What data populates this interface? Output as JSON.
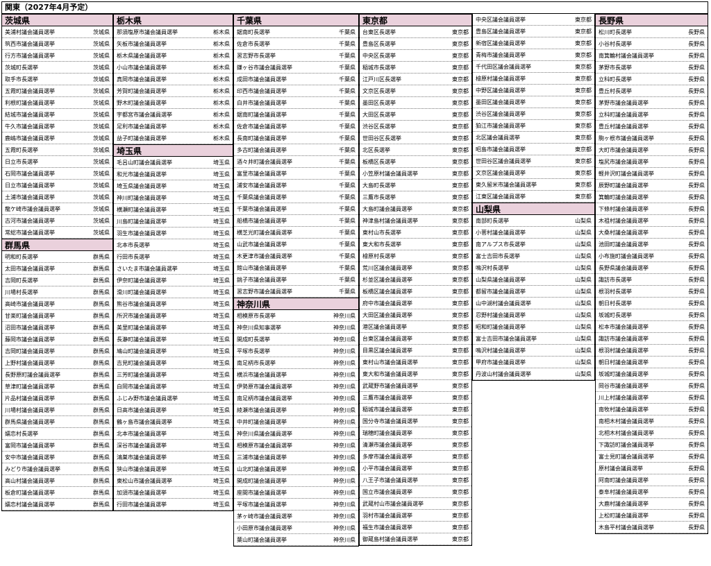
{
  "title": "関東（2027年4月予定）",
  "columns": [
    {
      "groups": [
        {
          "pref": "茨城県",
          "suffix": "茨城県",
          "items": [
            "美浦村議会議員選挙",
            "筑西市議会議員選挙",
            "行方市議会議員選挙",
            "茨城町長選挙",
            "取手市長選挙",
            "五霞町議会議員選挙",
            "利根町議会議員選挙",
            "結城市議会議員選挙",
            "牛久市議会議員選挙",
            "鹿嶋市議会議員選挙",
            "五霞町長選挙",
            "日立市長選挙",
            "石岡市議会議員選挙",
            "日立市議会議員選挙",
            "土浦市議会議員選挙",
            "龍ケ崎市議会議員選挙",
            "古河市議会議員選挙",
            "常総市議会議員選挙"
          ]
        },
        {
          "pref": "群馬県",
          "suffix": "群馬県",
          "items": [
            "明和町長選挙",
            "太田市議会議員選挙",
            "吉岡町長選挙",
            "川場村長選挙",
            "高崎市議会議員選挙",
            "甘楽町議会議員選挙",
            "沼田市議会議員選挙",
            "藤岡市議会議員選挙",
            "吉岡町議会議員選挙",
            "上野村議会議員選挙",
            "長野原町議会議員選挙",
            "草津町議会議員選挙",
            "片品村議会議員選挙",
            "川場村議会議員選挙",
            "群馬県議会議員選挙",
            "嬬恋村長選挙",
            "富岡市議会議員選挙",
            "安中市議会議員選挙",
            "みどり市議会議員選挙",
            "高山村議会議員選挙",
            "板倉町議会議員選挙",
            "嬬恋村議会議員選挙"
          ]
        }
      ]
    },
    {
      "groups": [
        {
          "pref": "栃木県",
          "suffix": "栃木県",
          "items": [
            "那須塩原市議会議員選挙",
            "矢板市議会議員選挙",
            "栃木県議会議員選挙",
            "小山市議会議員選挙",
            "真岡市議会議員選挙",
            "芳賀町議会議員選挙",
            "野木町議会議員選挙",
            "宇都宮市議会議員選挙",
            "足利市議会議員選挙",
            "益子町議会議員選挙"
          ]
        },
        {
          "pref": "埼玉県",
          "suffix": "埼玉県",
          "items": [
            "毛呂山町議会議員選挙",
            "和光市議会議員選挙",
            "埼玉県議会議員選挙",
            "神川町議会議員選挙",
            "横瀬町議会議員選挙",
            "川島町議会議員選挙",
            "羽生市議会議員選挙",
            "北本市長選挙",
            "行田市長選挙",
            "さいたま市議会議員選挙",
            "伊奈町議会議員選挙",
            "滑川町議会議員選挙",
            "熊谷市議会議員選挙",
            "所沢市議会議員選挙",
            "美里町議会議員選挙",
            "長瀞町議会議員選挙",
            "鳩山町議会議員選挙",
            "吉見町議会議員選挙",
            "三芳町議会議員選挙",
            "白岡市議会議員選挙",
            "ふじみ野市議会議員選挙",
            "日高市議会議員選挙",
            "鶴ヶ島市議会議員選挙",
            "北本市議会議員選挙",
            "深谷市議会議員選挙",
            "鴻巣市議会議員選挙",
            "狭山市議会議員選挙",
            "東松山市議会議員選挙",
            "加須市議会議員選挙",
            "行田市議会議員選挙"
          ]
        }
      ]
    },
    {
      "groups": [
        {
          "pref": "千葉県",
          "suffix": "千葉県",
          "items": [
            "鋸南町長選挙",
            "佐倉市長選挙",
            "習志野市長選挙",
            "鎌ヶ谷市議会議員選挙",
            "成田市議会議員選挙",
            "印西市議会議員選挙",
            "白井市議会議員選挙",
            "鋸南町議会議員選挙",
            "佐倉市議会議員選挙",
            "長南町議会議員選挙",
            "多古町議会議員選挙",
            "酒々井町議会議員選挙",
            "富里市議会議員選挙",
            "浦安市議会議員選挙",
            "千葉県議会議員選挙",
            "千葉市議会議員選挙",
            "船橋市議会議員選挙",
            "横芝光町議会議員選挙",
            "山武市議会議員選挙",
            "木更津市議会議員選挙",
            "館山市議会議員選挙",
            "銚子市議会議員選挙",
            "習志野市議会議員選挙"
          ]
        },
        {
          "pref": "神奈川県",
          "suffix": "神奈川県",
          "items": [
            "相模原市長選挙",
            "神奈川県知事選挙",
            "開成町長選挙",
            "平塚市長選挙",
            "南足柄市長選挙",
            "横浜市議会議員選挙",
            "伊勢原市議会議員選挙",
            "南足柄市議会議員選挙",
            "綾瀬市議会議員選挙",
            "中井町議会議員選挙",
            "神奈川県議会議員選挙",
            "相模原市議会議員選挙",
            "三浦市議会議員選挙",
            "山北町議会議員選挙",
            "開成町議会議員選挙",
            "座間市議会議員選挙",
            "平塚市議会議員選挙",
            "茅ヶ崎市議会議員選挙",
            "小田原市議会議員選挙",
            "葉山町議会議員選挙"
          ]
        }
      ]
    },
    {
      "groups": [
        {
          "pref": "東京都",
          "suffix": "東京都",
          "items": [
            "台東区長選挙",
            "豊島区長選挙",
            "中央区長選挙",
            "稲城市長選挙",
            "江戸川区長選挙",
            "文京区長選挙",
            "墨田区長選挙",
            "大田区長選挙",
            "渋谷区長選挙",
            "世田谷区長選挙",
            "北区長選挙",
            "板橋区長選挙",
            "小笠原村議会議員選挙",
            "大島町長選挙",
            "三鷹市長選挙",
            "大島町議会議員選挙",
            "神津島村議会議員選挙",
            "東村山市長選挙",
            "東大和市長選挙",
            "檜原村長選挙",
            "荒川区議会議員選挙",
            "杉並区議会議員選挙",
            "板橋区議会議員選挙",
            "府中市議会議員選挙",
            "大田区議会議員選挙",
            "港区議会議員選挙",
            "台東区議会議員選挙",
            "目黒区議会議員選挙",
            "東村山市議会議員選挙",
            "東大和市議会議員選挙",
            "武蔵野市議会議員選挙",
            "三鷹市議会議員選挙",
            "稲城市議会議員選挙",
            "国分寺市議会議員選挙",
            "瑞穂町議会議員選挙",
            "清瀬市議会議員選挙",
            "多摩市議会議員選挙",
            "小平市議会議員選挙",
            "八王子市議会議員選挙",
            "国立市議会議員選挙",
            "武蔵村山市議会議員選挙",
            "羽村市議会議員選挙",
            "福生市議会議員選挙",
            "御蔵島村議会議員選挙"
          ]
        }
      ]
    },
    {
      "groups": [
        {
          "pref": "",
          "suffix": "東京都",
          "items": [
            "中央区議会議員選挙",
            "豊島区議会議員選挙",
            "新宿区議会議員選挙",
            "青梅市議会議員選挙",
            "千代田区議会議員選挙",
            "檜原村議会議員選挙",
            "中野区議会議員選挙",
            "墨田区議会議員選挙",
            "渋谷区議会議員選挙",
            "狛江市議会議員選挙",
            "北区議会議員選挙",
            "昭島市議会議員選挙",
            "世田谷区議会議員選挙",
            "文京区議会議員選挙",
            "東久留米市議会議員選挙",
            "江東区議会議員選挙"
          ]
        },
        {
          "pref": "山梨県",
          "suffix": "山梨県",
          "items": [
            "南部町長選挙",
            "小菅村議会議員選挙",
            "南アルプス市長選挙",
            "富士吉田市長選挙",
            "鳴沢村長選挙",
            "山梨県議会議員選挙",
            "都留市議会議員選挙",
            "山中湖村議会議員選挙",
            "忍野村議会議員選挙",
            "昭和町議会議員選挙",
            "富士吉田市議会議員選挙",
            "鳴沢村議会議員選挙",
            "甲府市議会議員選挙",
            "丹波山村議会議員選挙"
          ]
        }
      ]
    },
    {
      "groups": [
        {
          "pref": "長野県",
          "suffix": "長野県",
          "items": [
            "松川町長選挙",
            "小谷村長選挙",
            "南箕輪村議会議員選挙",
            "茅野市長選挙",
            "立科町長選挙",
            "豊丘村長選挙",
            "茅野市議会議員選挙",
            "立科町議会議員選挙",
            "豊丘村議会議員選挙",
            "駒ヶ根市議会議員選挙",
            "大町市議会議員選挙",
            "塩尻市議会議員選挙",
            "軽井沢町議会議員選挙",
            "辰野町議会議員選挙",
            "箕輪町議会議員選挙",
            "下條村議会議員選挙",
            "木祖村議会議員選挙",
            "大桑村議会議員選挙",
            "池田町議会議員選挙",
            "小布施町議会議員選挙",
            "長野県議会議員選挙",
            "諏訪市長選挙",
            "根羽村長選挙",
            "朝日村長選挙",
            "坂城町長選挙",
            "松本市議会議員選挙",
            "諏訪市議会議員選挙",
            "根羽村議会議員選挙",
            "朝日村議会議員選挙",
            "坂城町議会議員選挙",
            "岡谷市議会議員選挙",
            "川上村議会議員選挙",
            "南牧村議会議員選挙",
            "南相木村議会議員選挙",
            "北相木村議会議員選挙",
            "下諏訪町議会議員選挙",
            "富士見町議会議員選挙",
            "原村議会議員選挙",
            "阿南町議会議員選挙",
            "泰阜村議会議員選挙",
            "大鹿村議会議員選挙",
            "上松町議会議員選挙",
            "木島平村議会議員選挙"
          ]
        }
      ]
    }
  ]
}
